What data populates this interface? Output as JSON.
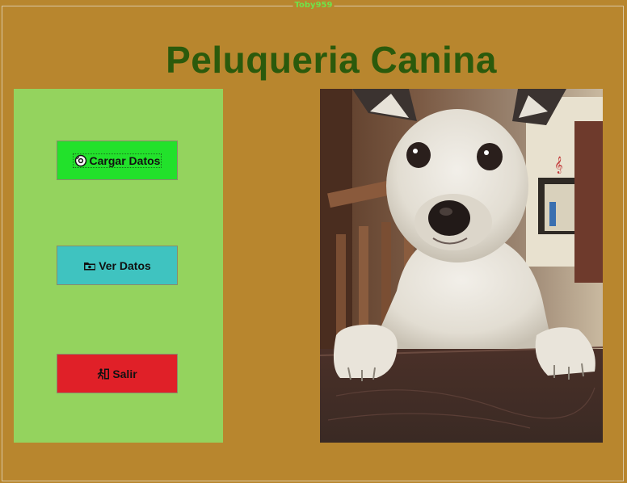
{
  "window": {
    "frame_title": "Toby959",
    "heading": "Peluqueria Canina"
  },
  "menu": {
    "buttons": [
      {
        "label": "Cargar Datos",
        "icon": "disc-icon",
        "color": "#22e12b"
      },
      {
        "label": "Ver Datos",
        "icon": "folder-icon",
        "color": "#3fc3c0"
      },
      {
        "label": "Salir",
        "icon": "exit-icon",
        "color": "#e02028"
      }
    ]
  },
  "photo": {
    "subject": "dog-photo"
  },
  "colors": {
    "background": "#b8862e",
    "panel": "#94d35e",
    "title": "#2b5a0c",
    "frame_title": "#6fe34a"
  }
}
